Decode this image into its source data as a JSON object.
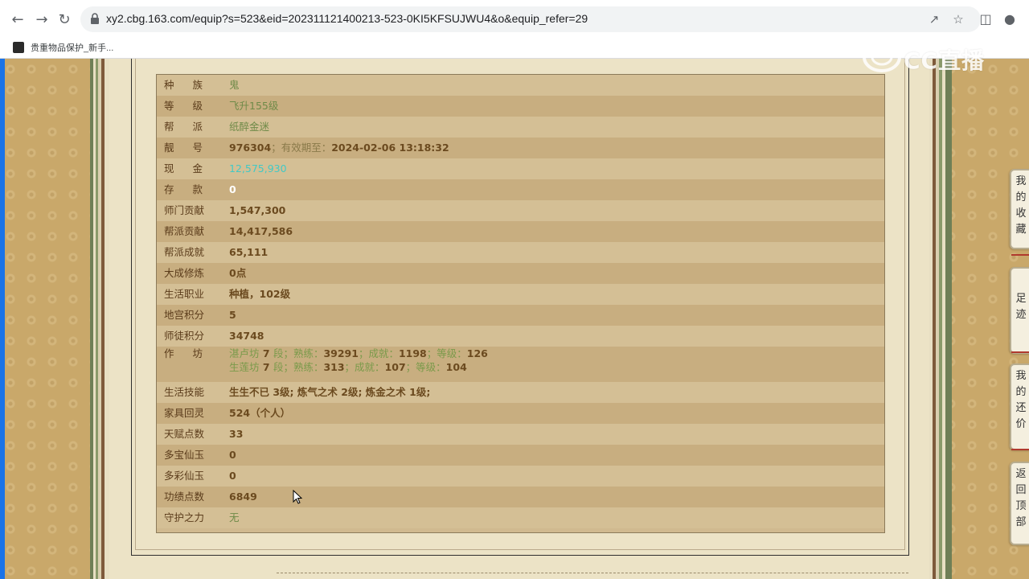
{
  "browser": {
    "url": "xy2.cbg.163.com/equip?s=523&eid=202311121400213-523-0KI5KFSUJWU4&o&equip_refer=29",
    "bookmark_label": "贵重物品保护_新手..."
  },
  "watermark": {
    "text": "CC直播"
  },
  "info": {
    "race_label": "种族",
    "race_value": "鬼",
    "level_label": "等级",
    "level_value": "飞升155级",
    "guild_label": "帮派",
    "guild_value": "纸醉金迷",
    "pretty_label": "靓号",
    "pretty_value": "976304",
    "pretty_expire_label": "；有效期至：",
    "pretty_expire_value": "2024-02-06 13:18:32",
    "cash_label": "现金",
    "cash_value": "12,575,930",
    "deposit_label": "存款",
    "deposit_value": "0",
    "school_contrib_label": "师门贡献",
    "school_contrib_value": "1,547,300",
    "guild_contrib_label": "帮派贡献",
    "guild_contrib_value": "14,417,586",
    "guild_achieve_label": "帮派成就",
    "guild_achieve_value": "65,111",
    "dacheng_label": "大成修炼",
    "dacheng_value": "0点",
    "life_job_label": "生活职业",
    "life_job_value": "种植，102级",
    "dungeon_label": "地宫积分",
    "dungeon_value": "5",
    "apprentice_label": "师徒积分",
    "apprentice_value": "34748",
    "workshop_label": "作坊",
    "workshop_line1": {
      "name": "湛卢坊",
      "stage": "7",
      "seg": "段；熟练：",
      "skill": "39291",
      "ach_label": "；成就：",
      "ach": "1198",
      "lvl_label": "；等级：",
      "lvl": "126"
    },
    "workshop_line2": {
      "name": "生莲坊",
      "stage": "7",
      "seg": "段；熟练：",
      "skill": "313",
      "ach_label": "；成就：",
      "ach": "107",
      "lvl_label": "；等级：",
      "lvl": "104"
    },
    "life_skill_label": "生活技能",
    "life_skill_value": "生生不已 3级; 炼气之术 2级; 炼金之术 1级;",
    "home_label": "家具回灵",
    "home_value": "524（个人）",
    "talent_label": "天赋点数",
    "talent_value": "33",
    "duobao_label": "多宝仙玉",
    "duobao_value": "0",
    "duocai_label": "多彩仙玉",
    "duocai_value": "0",
    "merit_label": "功绩点数",
    "merit_value": "6849",
    "guard_label": "守护之力",
    "guard_value": "无"
  },
  "sidetabs": {
    "fav": [
      "我",
      "的",
      "收",
      "藏"
    ],
    "trace": [
      "足",
      "迹"
    ],
    "bargain": [
      "我",
      "的",
      "还",
      "价"
    ],
    "top": [
      "返",
      "回",
      "顶",
      "部"
    ]
  }
}
